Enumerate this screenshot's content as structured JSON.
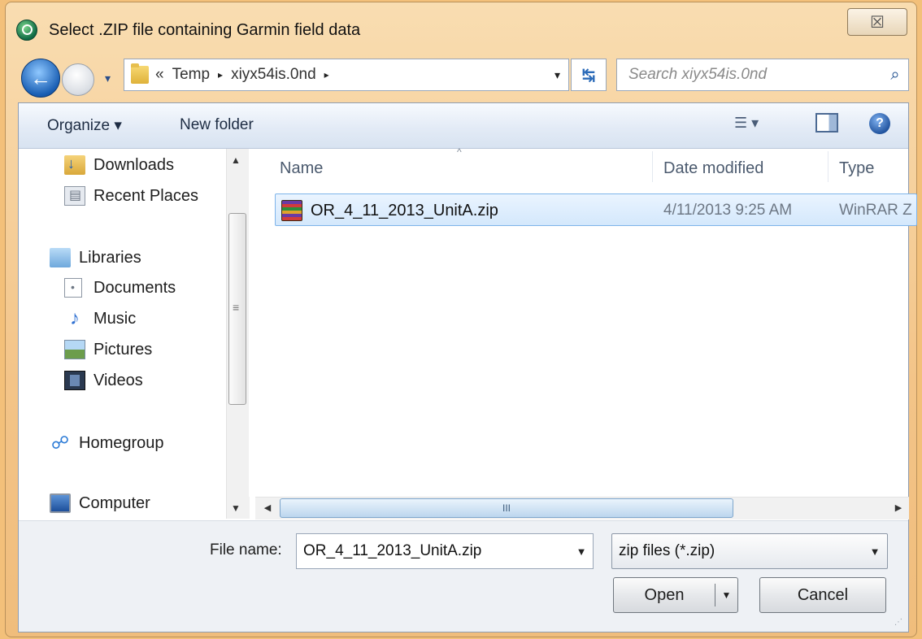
{
  "window": {
    "title": "Select .ZIP file containing Garmin field data",
    "close_glyph": "☒"
  },
  "nav": {
    "back_glyph": "←",
    "history_glyph": "▾",
    "breadcrumb": {
      "overflow": "«",
      "items": [
        "Temp",
        "xiyx54is.0nd"
      ],
      "separator": "▸"
    },
    "address_dropdown": "▾",
    "refresh_glyph": "↹"
  },
  "search": {
    "placeholder": "Search xiyx54is.0nd",
    "icon": "search-icon"
  },
  "toolbar": {
    "organize_label": "Organize ▾",
    "new_folder_label": "New folder",
    "view_glyph": "☰ ▾",
    "help_glyph": "?"
  },
  "sidebar": {
    "items": [
      {
        "label": "Downloads",
        "icon": "downloads-icon"
      },
      {
        "label": "Recent Places",
        "icon": "recent-places-icon"
      },
      {
        "label": "Libraries",
        "icon": "libraries-icon"
      },
      {
        "label": "Documents",
        "icon": "documents-icon"
      },
      {
        "label": "Music",
        "icon": "music-icon"
      },
      {
        "label": "Pictures",
        "icon": "pictures-icon"
      },
      {
        "label": "Videos",
        "icon": "videos-icon"
      },
      {
        "label": "Homegroup",
        "icon": "homegroup-icon"
      },
      {
        "label": "Computer",
        "icon": "computer-icon"
      }
    ],
    "music_glyph": "♪",
    "homegroup_glyph": "☍"
  },
  "file_list": {
    "columns": [
      "Name",
      "Date modified",
      "Type"
    ],
    "sort_glyph": "^",
    "rows": [
      {
        "name": "OR_4_11_2013_UnitA.zip",
        "date": "4/11/2013 9:25 AM",
        "type": "WinRAR Z",
        "selected": true
      }
    ]
  },
  "scrollbars": {
    "up": "▲",
    "down": "▼",
    "left": "◀",
    "right": "▶",
    "grip_v": "≡",
    "grip_h": "III"
  },
  "footer": {
    "file_name_label": "File name:",
    "file_name_value": "OR_4_11_2013_UnitA.zip",
    "file_type_value": "zip files (*.zip)",
    "dropdown_glyph": "▼",
    "open_label": "Open",
    "cancel_label": "Cancel",
    "resize_glyph": "⋰"
  },
  "colors": {
    "frame": "#f3c07a",
    "toolbar": "#dfe8f4",
    "selection": "#d4e8fc",
    "accent": "#1a5fb4"
  }
}
